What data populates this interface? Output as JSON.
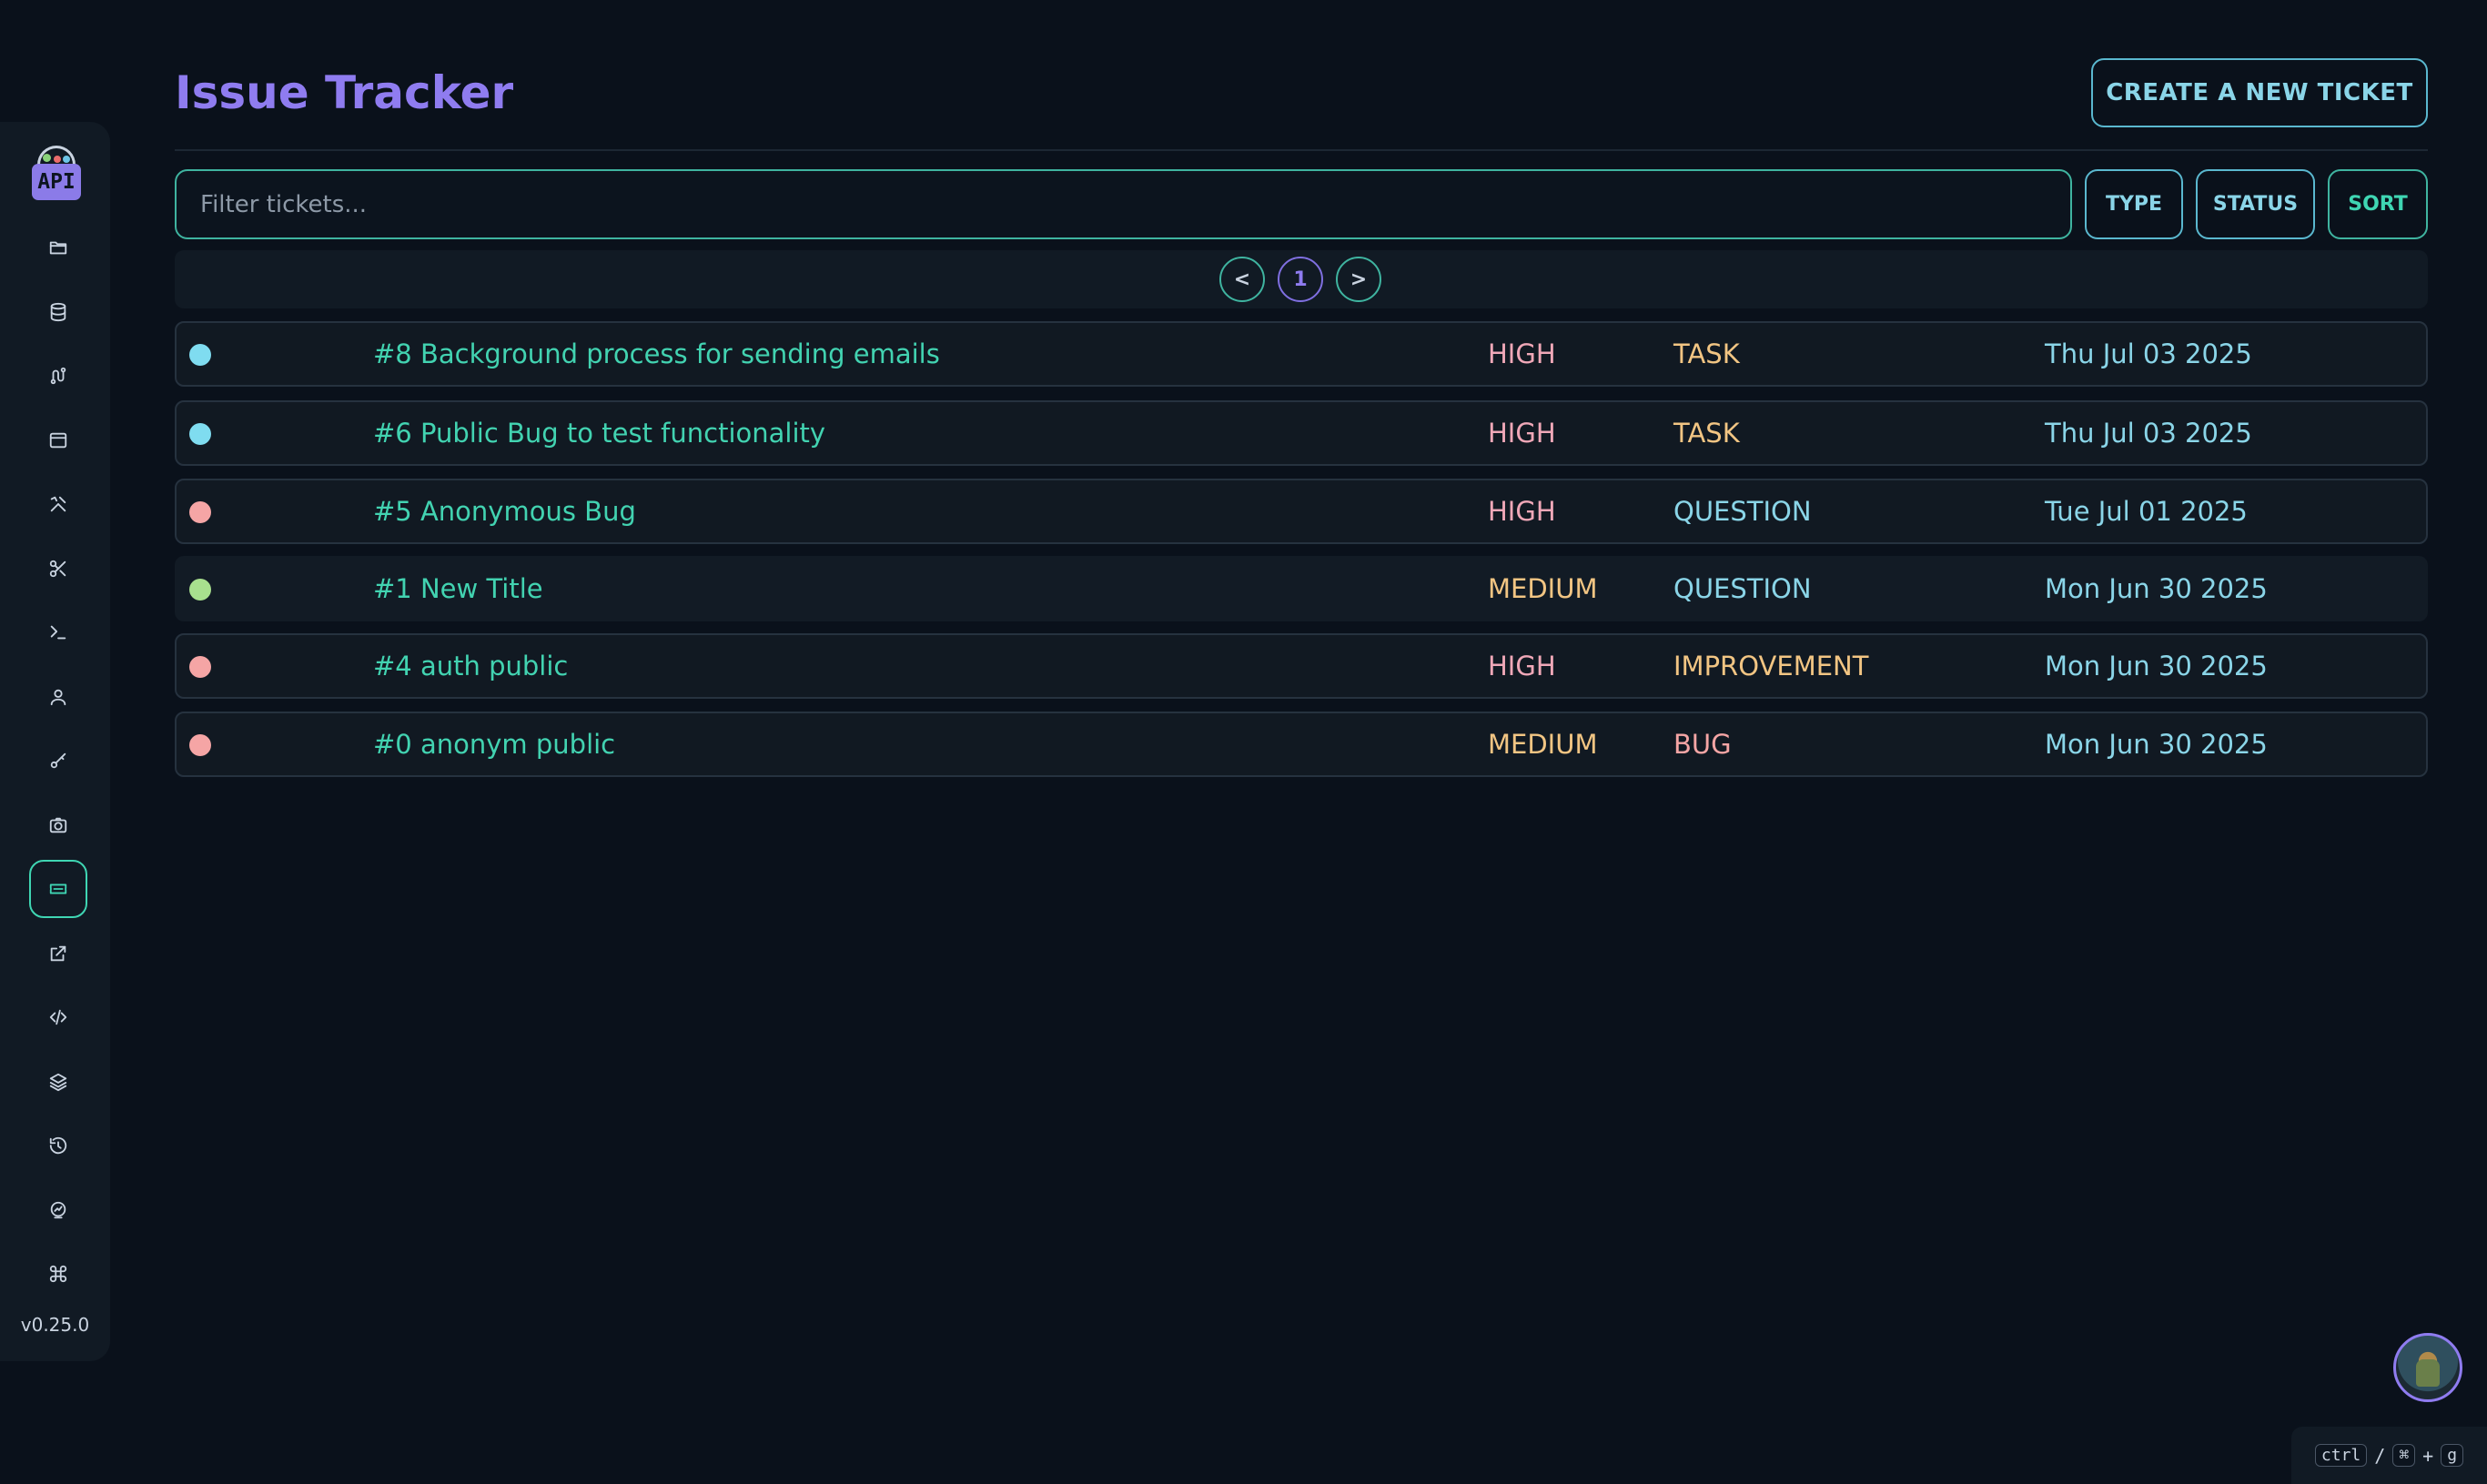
{
  "app": {
    "title": "Issue Tracker",
    "version": "v0.25.0"
  },
  "header": {
    "create_label": "CREATE A NEW TICKET"
  },
  "filter": {
    "placeholder": "Filter tickets...",
    "value": "",
    "type_label": "TYPE",
    "status_label": "STATUS",
    "sort_label": "SORT"
  },
  "pagination": {
    "prev_label": "<",
    "current_page": "1",
    "next_label": ">"
  },
  "sidebar": {
    "icons": [
      "folder-icon",
      "database-icon",
      "route-icon",
      "window-icon",
      "tools-icon",
      "scissors-icon",
      "terminal-icon",
      "user-icon",
      "key-icon",
      "camera-icon",
      "ticket-icon",
      "external-link-icon",
      "code-icon",
      "layers-icon",
      "history-icon",
      "chart-icon",
      "command-icon"
    ],
    "active_icon": "ticket-icon"
  },
  "tickets": [
    {
      "title": "#8 Background process for sending emails",
      "priority": "HIGH",
      "type": "TASK",
      "date": "Thu Jul 03 2025",
      "dot_color": "#7fdcf0"
    },
    {
      "title": "#6 Public Bug to test functionality",
      "priority": "HIGH",
      "type": "TASK",
      "date": "Thu Jul 03 2025",
      "dot_color": "#7fdcf0"
    },
    {
      "title": "#5 Anonymous Bug",
      "priority": "HIGH",
      "type": "QUESTION",
      "date": "Tue Jul 01 2025",
      "dot_color": "#f5a5a5"
    },
    {
      "title": "#1 New Title",
      "priority": "MEDIUM",
      "type": "QUESTION",
      "date": "Mon Jun 30 2025",
      "dot_color": "#a8e08e"
    },
    {
      "title": "#4 auth public",
      "priority": "HIGH",
      "type": "IMPROVEMENT",
      "date": "Mon Jun 30 2025",
      "dot_color": "#f5a5a5"
    },
    {
      "title": "#0 anonym public",
      "priority": "MEDIUM",
      "type": "BUG",
      "date": "Mon Jun 30 2025",
      "dot_color": "#f5a5a5"
    }
  ],
  "colors": {
    "priority_high": "#f0a8b8",
    "priority_medium": "#f2c583",
    "type_task": "#f2c583",
    "type_question": "#8ad5e8",
    "type_improvement": "#f2c583",
    "type_bug": "#f5a5a5"
  },
  "shortcut": {
    "key1": "ctrl",
    "sep": "/",
    "key2": "⌘",
    "plus": "+",
    "key3": "g"
  }
}
